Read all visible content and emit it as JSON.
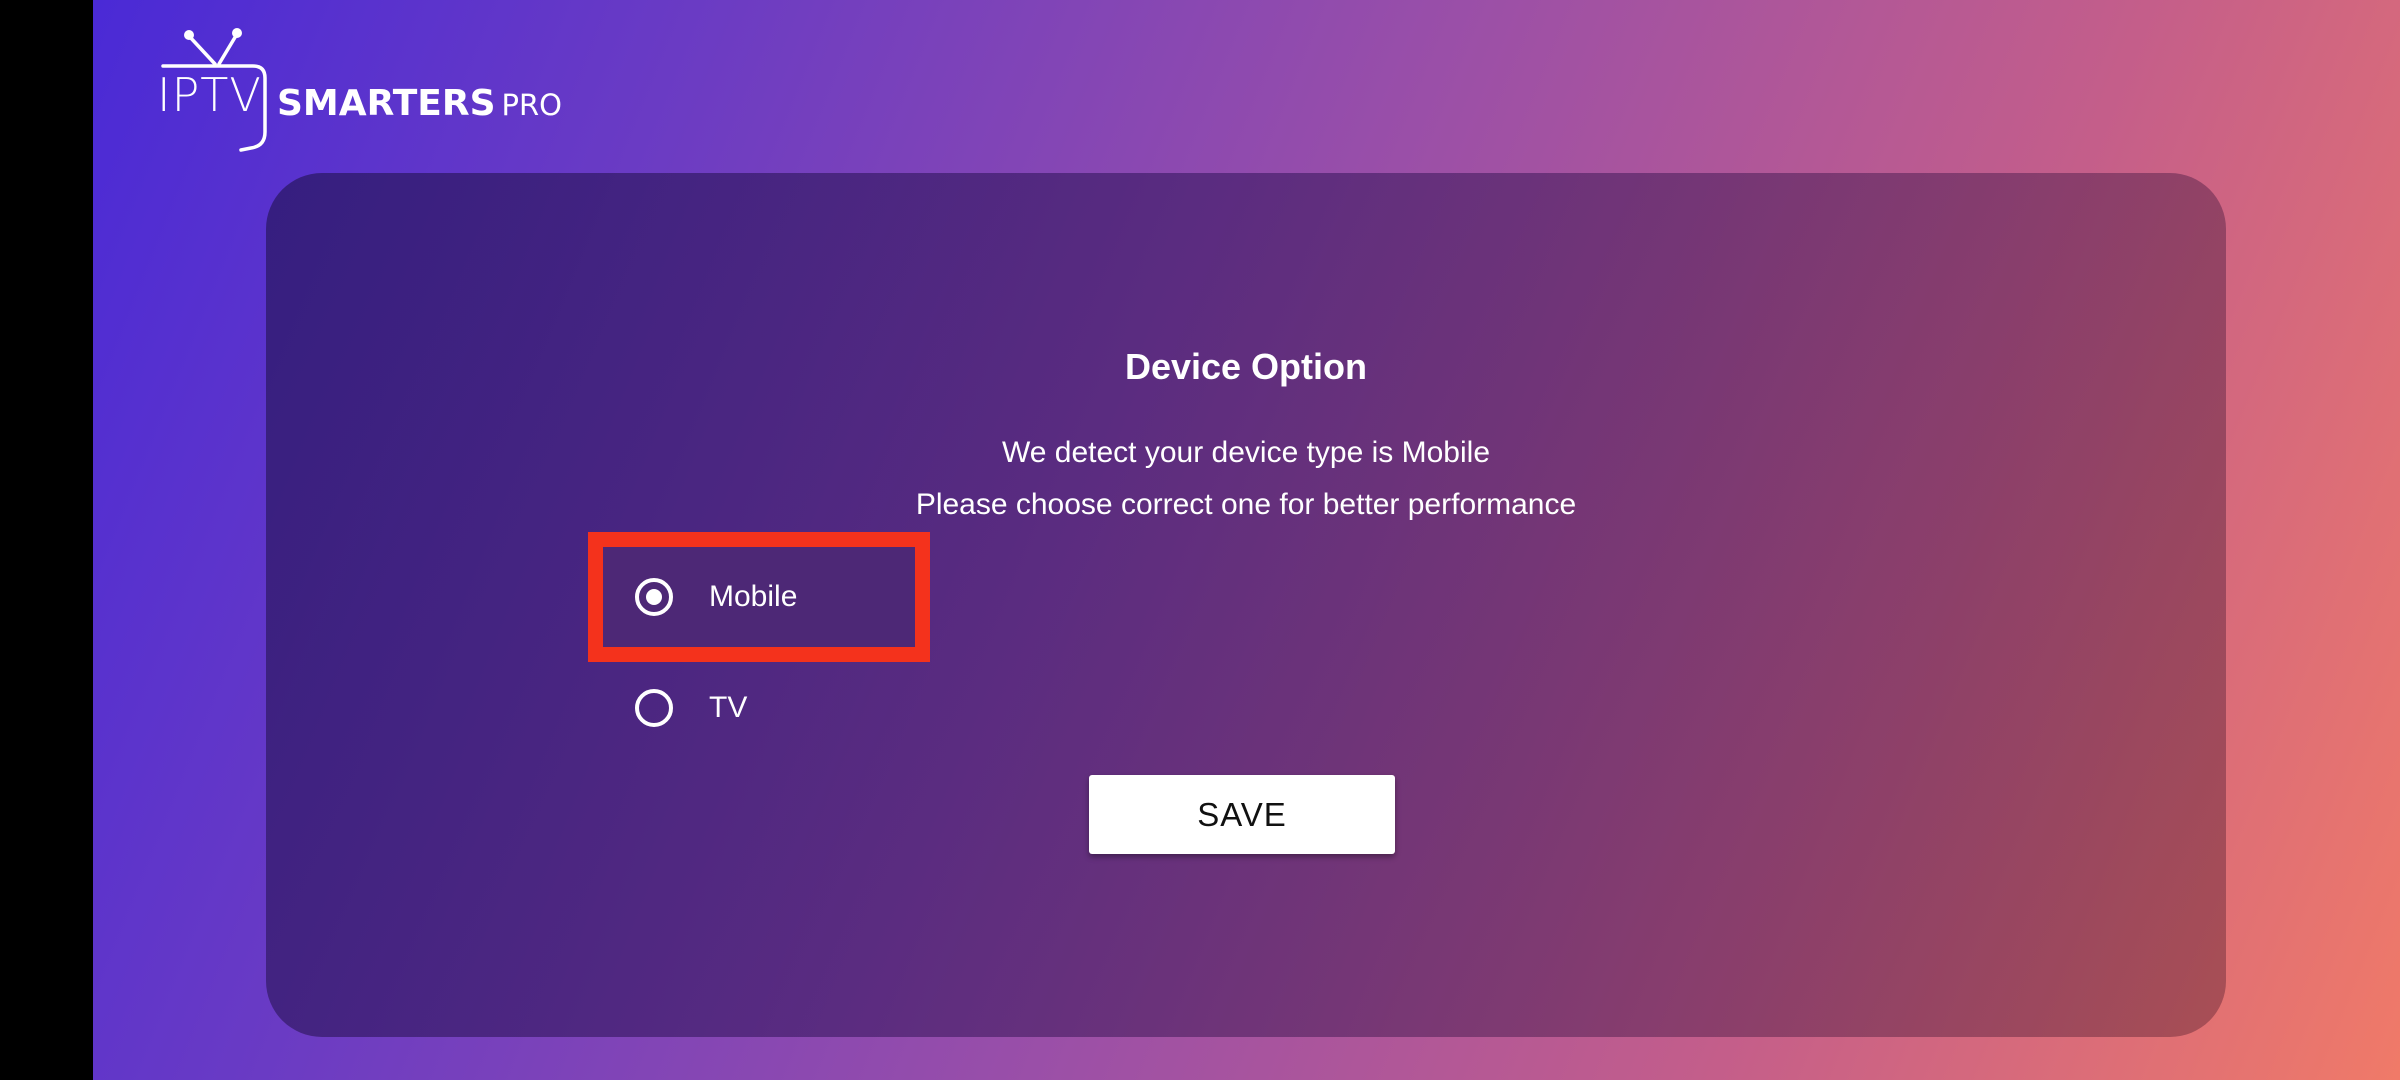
{
  "brand": {
    "iptv": "IPTV",
    "smarters": "SMARTERS",
    "pro": "PRO"
  },
  "dialog": {
    "title": "Device Option",
    "line1": "We detect your device type is Mobile",
    "line2": "Please choose correct one for better performance",
    "options": [
      {
        "label": "Mobile",
        "selected": true
      },
      {
        "label": "TV",
        "selected": false
      }
    ],
    "save_label": "SAVE"
  },
  "colors": {
    "highlight_border": "#f4321c",
    "button_bg": "#ffffff",
    "gradient_start": "#4a2ad6",
    "gradient_end": "#f07a68"
  },
  "icons": {
    "logo": "tv-antenna-icon"
  }
}
